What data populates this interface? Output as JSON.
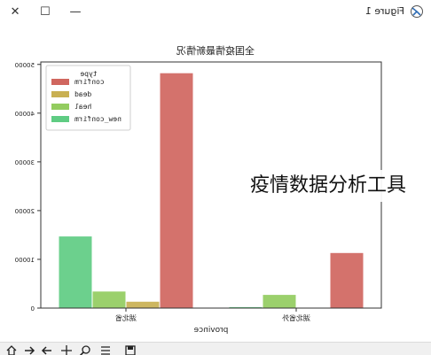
{
  "window": {
    "title": "Figure 1",
    "minimize_label": "—",
    "maximize_label": "☐",
    "close_label": "✕"
  },
  "overlay_text": "疫情数据分析工具",
  "toolbar": {
    "icons": [
      "home-icon",
      "back-icon",
      "forward-icon",
      "pan-icon",
      "zoom-icon",
      "configure-subplots-icon",
      "save-icon"
    ]
  },
  "chart_data": {
    "type": "bar",
    "title": "全国疫情最新情况",
    "xlabel": "province",
    "ylabel": "",
    "categories": [
      "湖北省外",
      "湖北省"
    ],
    "series": [
      {
        "name": "confirm",
        "color": "#d0665f",
        "values": [
          11300,
          48200
        ]
      },
      {
        "name": "dead",
        "color": "#c9b052",
        "values": [
          80,
          1300
        ]
      },
      {
        "name": "heal",
        "color": "#93cc5f",
        "values": [
          2700,
          3400
        ]
      },
      {
        "name": "new_confirm",
        "color": "#5fcc83",
        "values": [
          200,
          14700
        ]
      }
    ],
    "yticks": [
      0,
      10000,
      20000,
      30000,
      40000,
      50000
    ],
    "ytick_labels": [
      "0",
      "10000",
      "20000",
      "30000",
      "40000",
      "50000"
    ],
    "ylim": [
      0,
      50500
    ],
    "legend": {
      "title": "type",
      "position": "top-left"
    },
    "grid": false
  }
}
